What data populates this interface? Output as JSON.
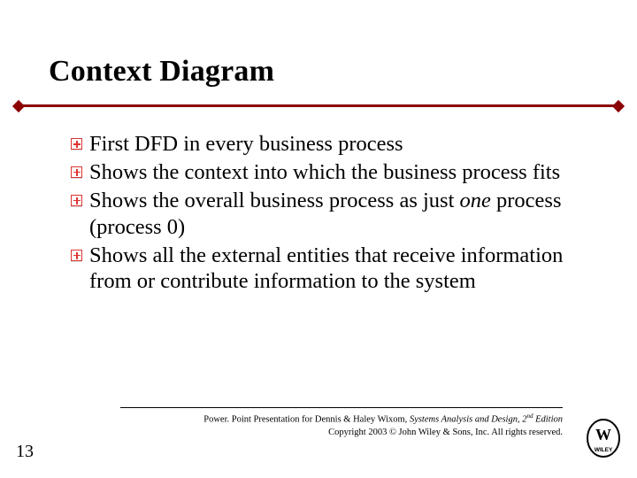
{
  "title": "Context Diagram",
  "bullets": [
    {
      "text": "First DFD in every business process"
    },
    {
      "text": "Shows the context into which the business process fits"
    },
    {
      "pre": "Shows the overall business process as just ",
      "ital": "one",
      "post": " process (process 0)"
    },
    {
      "text": "Shows all the external entities that receive information from or contribute information to the system"
    }
  ],
  "footer": {
    "line1_pre": "Power. Point Presentation for Dennis & Haley Wixom, ",
    "line1_title": "Systems Analysis and Design, ",
    "line1_ed_pre": "2",
    "line1_ed_sup": "nd",
    "line1_ed_post": " Edition",
    "line2": "Copyright 2003 © John Wiley & Sons, Inc.  All rights reserved."
  },
  "page_number": "13",
  "logo_alt": "Wiley logo"
}
